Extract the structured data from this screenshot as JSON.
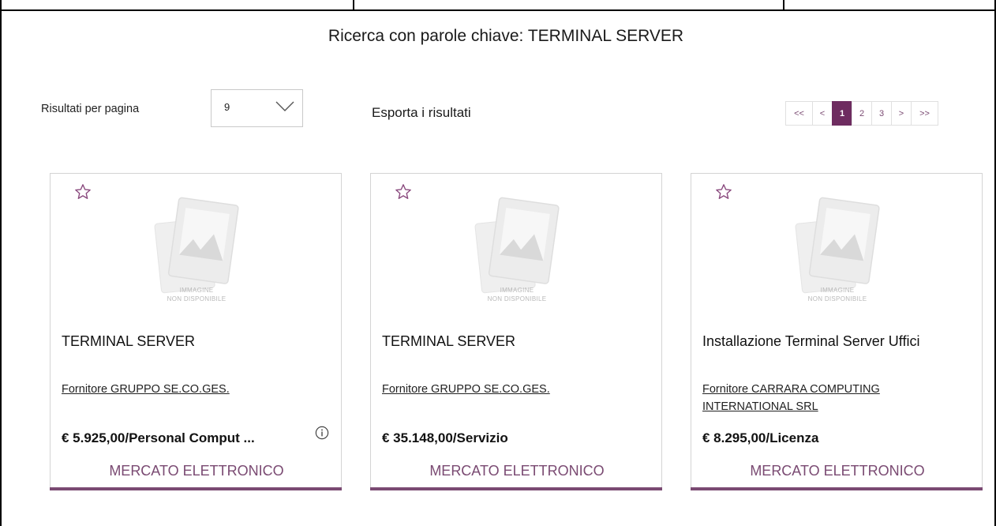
{
  "search": {
    "title": "Ricerca con parole chiave: TERMINAL SERVER"
  },
  "results_per_page": {
    "label": "Risultati per pagina",
    "value": "9"
  },
  "export": {
    "label": "Esporta i risultati"
  },
  "pagination": {
    "first": "<<",
    "prev": "<",
    "pages": [
      "1",
      "2",
      "3"
    ],
    "current": "1",
    "next": ">",
    "last": ">>"
  },
  "placeholder_text": {
    "line1": "IMMAGINE",
    "line2": "NON DISPONIBILE"
  },
  "cards": [
    {
      "name": "TERMINAL SERVER",
      "supplier": "Fornitore GRUPPO SE.CO.GES.",
      "price": "€ 5.925,00/Personal Comput ...",
      "market": "MERCATO ELETTRONICO",
      "has_info": true
    },
    {
      "name": "TERMINAL SERVER",
      "supplier": "Fornitore GRUPPO SE.CO.GES.",
      "price": "€ 35.148,00/Servizio",
      "market": "MERCATO ELETTRONICO",
      "has_info": false
    },
    {
      "name": "Installazione Terminal Server Uffici",
      "supplier": "Fornitore CARRARA COMPUTING INTERNATIONAL SRL",
      "price": "€ 8.295,00/Licenza",
      "market": "MERCATO ELETTRONICO",
      "has_info": false
    }
  ],
  "colors": {
    "accent": "#7a4a72",
    "accent_dark": "#6e2c60",
    "border": "#d4d4d4"
  },
  "icons": {
    "favorite": "star-outline-icon",
    "info": "info-circle-icon",
    "dropdown": "chevron-down-icon",
    "placeholder": "image-placeholder-icon"
  }
}
